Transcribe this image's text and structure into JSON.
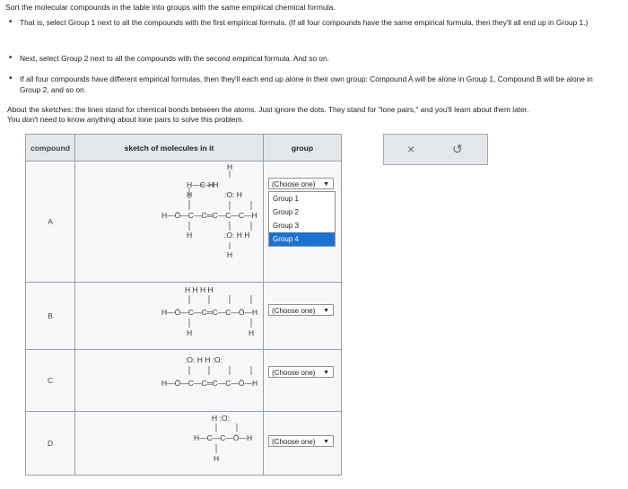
{
  "title": "Sort the molecular compounds in the table into groups with the same empirical chemical formula.",
  "bullets": [
    "That is, select Group 1 next to all the compounds with the first empirical formula. (If all four compounds have the same empirical formula, then they'll all end up in Group 1.)",
    "Next, select Group 2 next to all the compounds with the second empirical formula. And so on.",
    "If all four compounds have different empirical formulas, then they'll each end up alone in their own group: Compound A will be alone in Group 1, Compound B will be alone in Group 2, and so on."
  ],
  "about_lines": [
    "About the sketches: the lines stand for chemical bonds between the atoms. Just ignore the dots. They stand for \"lone pairs,\" and you'll learn about them later.",
    "You don't need to know anything about lone pairs to solve this problem."
  ],
  "table": {
    "headers": [
      "compound",
      "sketch of molecules in it",
      "group"
    ],
    "compounds": [
      "A",
      "B",
      "C",
      "D"
    ],
    "select_value": "(Choose one)",
    "dropdown_options": [
      "(Choose one)",
      "Group 1",
      "Group 2",
      "Group 3",
      "Group 4"
    ],
    "highlighted_option": "Group 4"
  },
  "tools": {
    "clear_icon": "×",
    "undo_icon": "↺"
  },
  "colors": {
    "header_bg": "#e3e6ea",
    "highlight": "#1a73d1"
  }
}
